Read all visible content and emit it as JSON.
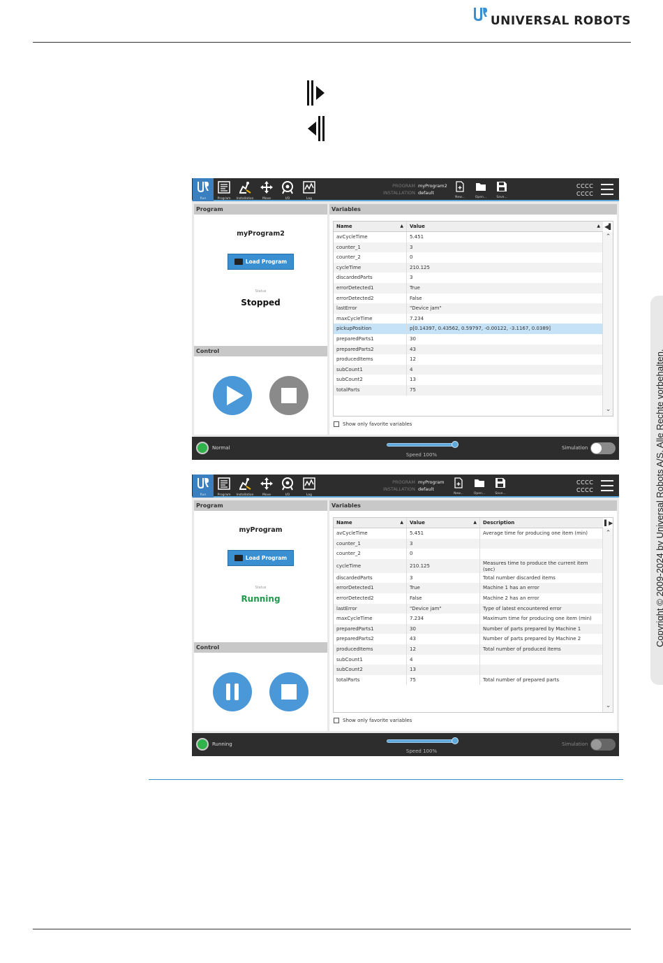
{
  "header": {
    "logo_text": "UNIVERSAL ROBOTS"
  },
  "side": {
    "copyright": "Copyright © 2009-2024 by Universal Robots A/S. Alle Rechte vorbehalten."
  },
  "toolbar_labels": [
    "Run",
    "Program",
    "Installation",
    "Move",
    "I/O",
    "Log"
  ],
  "file_labels": [
    "New...",
    "Open...",
    "Save..."
  ],
  "shot1": {
    "program_key": "PROGRAM",
    "program_val": "myProgram2",
    "installation_key": "INSTALLATION",
    "installation_val": "default",
    "cccc1": "CCCC",
    "cccc2": "CCCC",
    "left_heading": "Program",
    "program_name": "myProgram2",
    "load_label": "Load Program",
    "status_label": "Status",
    "status_value": "Stopped",
    "status_color": "#111111",
    "control_heading": "Control",
    "variables_heading": "Variables",
    "col_name": "Name",
    "col_value": "Value",
    "fav_label": "Show only favorite variables",
    "mode": "Normal",
    "speed": "Speed 100%",
    "simulation": "Simulation",
    "rows": [
      {
        "name": "avCycleTime",
        "value": "5.451"
      },
      {
        "name": "counter_1",
        "value": "3"
      },
      {
        "name": "counter_2",
        "value": "0"
      },
      {
        "name": "cycleTime",
        "value": "210.125"
      },
      {
        "name": "discardedParts",
        "value": "3"
      },
      {
        "name": "errorDetected1",
        "value": "True"
      },
      {
        "name": "errorDetected2",
        "value": "False"
      },
      {
        "name": "lastError",
        "value": "\"Device jam\""
      },
      {
        "name": "maxCycleTime",
        "value": "7.234"
      },
      {
        "name": "pickupPosition",
        "value": "p[0.14397, 0.43562, 0.59797, -0.00122, -3.1167, 0.0389]"
      },
      {
        "name": "preparedParts1",
        "value": "30"
      },
      {
        "name": "preparedParts2",
        "value": "43"
      },
      {
        "name": "producedItems",
        "value": "12"
      },
      {
        "name": "subCount1",
        "value": "4"
      },
      {
        "name": "subCount2",
        "value": "13"
      },
      {
        "name": "totalParts",
        "value": "75"
      }
    ]
  },
  "shot2": {
    "program_key": "PROGRAM",
    "program_val": "myProgram",
    "installation_key": "INSTALLATION",
    "installation_val": "default",
    "cccc1": "CCCC",
    "cccc2": "CCCC",
    "left_heading": "Program",
    "program_name": "myProgram",
    "load_label": "Load Program",
    "status_label": "Status",
    "status_value": "Running",
    "status_color": "#1f9a4a",
    "control_heading": "Control",
    "variables_heading": "Variables",
    "col_name": "Name",
    "col_value": "Value",
    "col_desc": "Description",
    "fav_label": "Show only favorite variables",
    "mode": "Running",
    "speed": "Speed 100%",
    "simulation": "Simulation",
    "rows": [
      {
        "name": "avCycleTime",
        "value": "5.451",
        "desc": "Average time for producing one item (min)"
      },
      {
        "name": "counter_1",
        "value": "3",
        "desc": ""
      },
      {
        "name": "counter_2",
        "value": "0",
        "desc": ""
      },
      {
        "name": "cycleTime",
        "value": "210.125",
        "desc": "Measures time to produce the current item (sec)"
      },
      {
        "name": "discardedParts",
        "value": "3",
        "desc": "Total number discarded items"
      },
      {
        "name": "errorDetected1",
        "value": "True",
        "desc": "Machine 1 has an error"
      },
      {
        "name": "errorDetected2",
        "value": "False",
        "desc": "Machine 2 has an error"
      },
      {
        "name": "lastError",
        "value": "\"Device jam\"",
        "desc": "Type of latest encountered error"
      },
      {
        "name": "maxCycleTime",
        "value": "7.234",
        "desc": "Maximum time for producing one item (min)"
      },
      {
        "name": "preparedParts1",
        "value": "30",
        "desc": "Number of parts prepared by Machine 1"
      },
      {
        "name": "preparedParts2",
        "value": "43",
        "desc": "Number of parts prepared by Machine 2"
      },
      {
        "name": "producedItems",
        "value": "12",
        "desc": "Total number of produced items"
      },
      {
        "name": "subCount1",
        "value": "4",
        "desc": ""
      },
      {
        "name": "subCount2",
        "value": "13",
        "desc": ""
      },
      {
        "name": "totalParts",
        "value": "75",
        "desc": "Total number of prepared parts"
      }
    ]
  },
  "colors": {
    "accent": "#3a8fd1",
    "topbar": "#2d2d2d",
    "selected_row": "#c6e2f6",
    "running_green": "#1f9a4a"
  }
}
